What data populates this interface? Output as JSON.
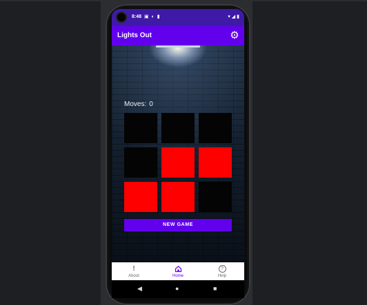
{
  "status_bar": {
    "time": "8:48",
    "icons_left": [
      "notification-icon",
      "sync-icon",
      "battery-saver-icon"
    ],
    "icons_right": [
      "wifi-icon",
      "signal-icon",
      "battery-icon"
    ]
  },
  "app_bar": {
    "title": "Lights Out",
    "settings_icon": "gear-icon"
  },
  "game": {
    "moves_label": "Moves:",
    "moves_value": "0",
    "board": [
      [
        false,
        false,
        false
      ],
      [
        false,
        true,
        true
      ],
      [
        true,
        true,
        false
      ]
    ],
    "colors": {
      "on": "#ff0000",
      "off": "#040404"
    },
    "new_game_label": "NEW GAME"
  },
  "bottom_nav": {
    "items": [
      {
        "label": "About",
        "icon": "info-icon",
        "active": false
      },
      {
        "label": "Home",
        "icon": "home-icon",
        "active": true
      },
      {
        "label": "Help",
        "icon": "help-icon",
        "active": false
      }
    ]
  },
  "system_nav": [
    "back-icon",
    "home-circle-icon",
    "recents-icon"
  ],
  "theme": {
    "primary": "#6200ee",
    "status_bar": "#3e1aa7"
  }
}
